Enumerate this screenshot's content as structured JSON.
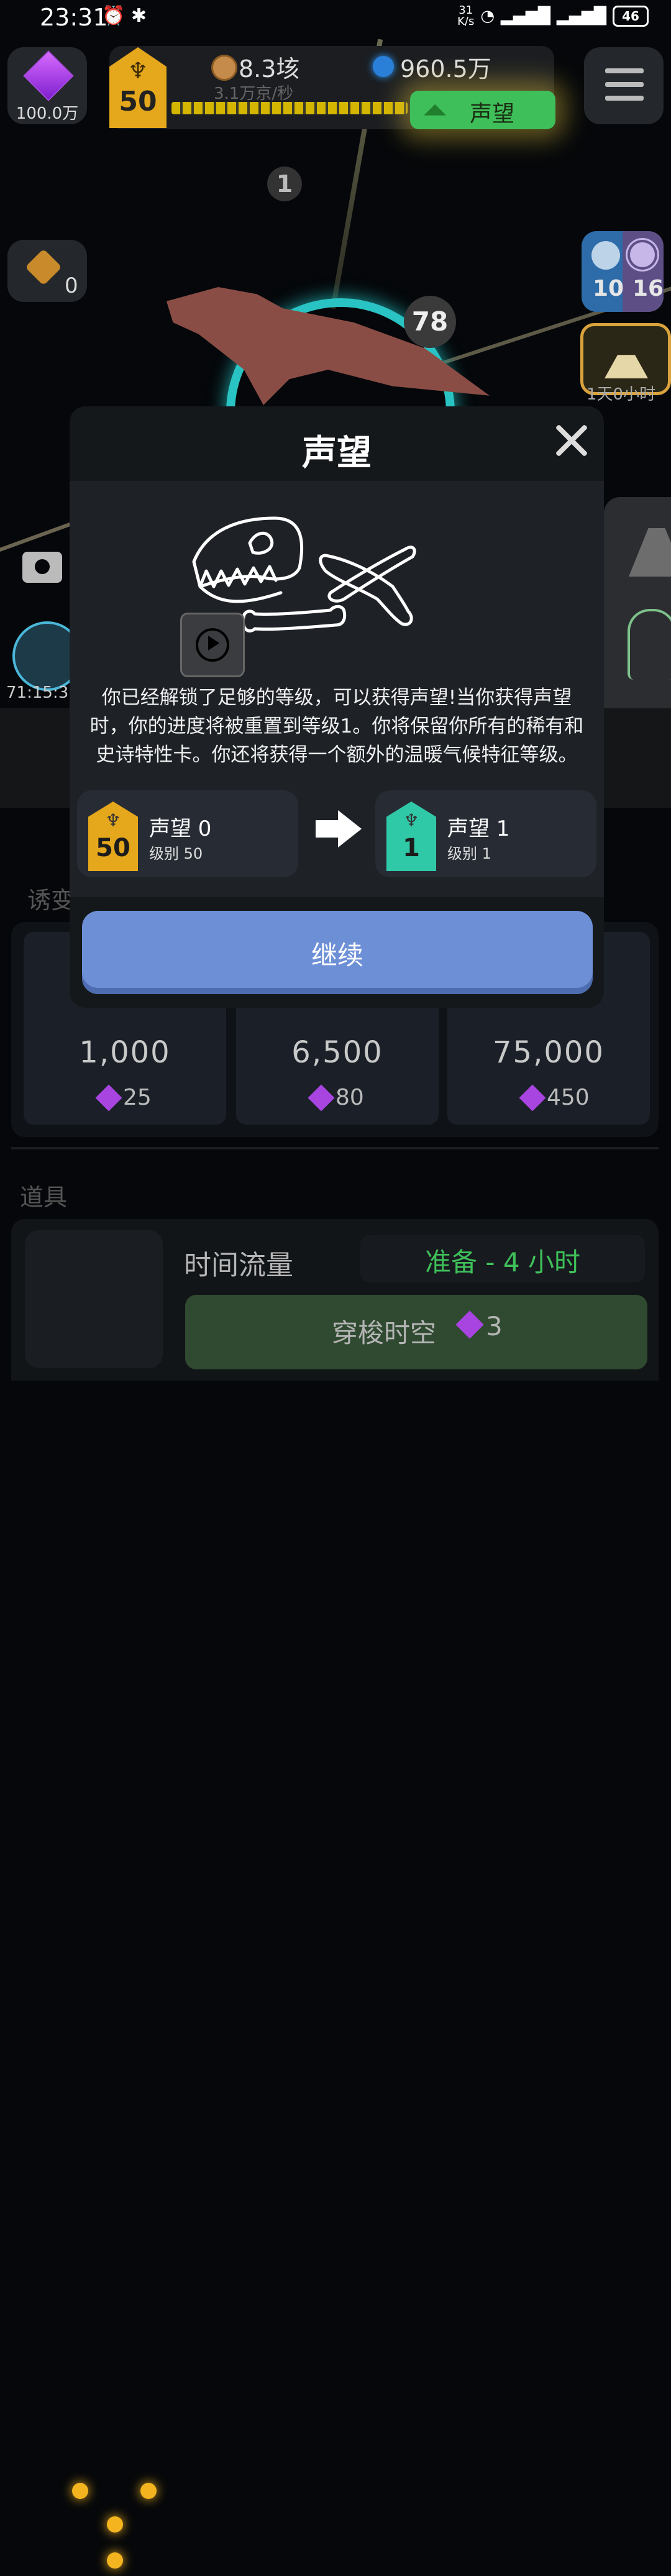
{
  "status_bar": {
    "time": "23:31",
    "net_speed_value": "31",
    "net_speed_unit": "K/s",
    "net1": "4G",
    "net2": "5G",
    "battery": "46"
  },
  "hud": {
    "cubes": "100.0万",
    "level": "50",
    "fossils": "8.3垓",
    "fossil_rate": "3.1万京/秒",
    "dna": "960.5万",
    "prestige_label": "声望",
    "xp_progress": 0.7
  },
  "scene": {
    "node_badge": "1",
    "level_badge": "78",
    "gear_count": "0",
    "world_count": "10",
    "planet_count": "16",
    "volcano_timer": "1天0小时",
    "claw_timer": "71:15:3"
  },
  "modal": {
    "title": "声望",
    "description": "你已经解锁了足够的等级，可以获得声望!当你获得声望时，你的进度将被重置到等级1。你将保留你所有的稀有和史诗特性卡。你还将获得一个额外的温暖气候特征等级。",
    "from": {
      "shield": "50",
      "name": "声望 0",
      "level": "级别 50",
      "color": "#e5a71b"
    },
    "to": {
      "shield": "1",
      "name": "声望 1",
      "level": "级别 1",
      "color": "#2fc9a8"
    },
    "continue_label": "继续"
  },
  "mutations": {
    "section_label": "诱变",
    "cards": [
      {
        "cost": "1,000",
        "gems": "25"
      },
      {
        "cost": "6,500",
        "gems": "80"
      },
      {
        "cost": "75,000",
        "gems": "450"
      }
    ]
  },
  "props": {
    "section_label": "道具",
    "item_name": "时间流量",
    "ready_text": "准备 - 4 小时",
    "warp_label": "穿梭时空",
    "warp_cost": "3"
  }
}
